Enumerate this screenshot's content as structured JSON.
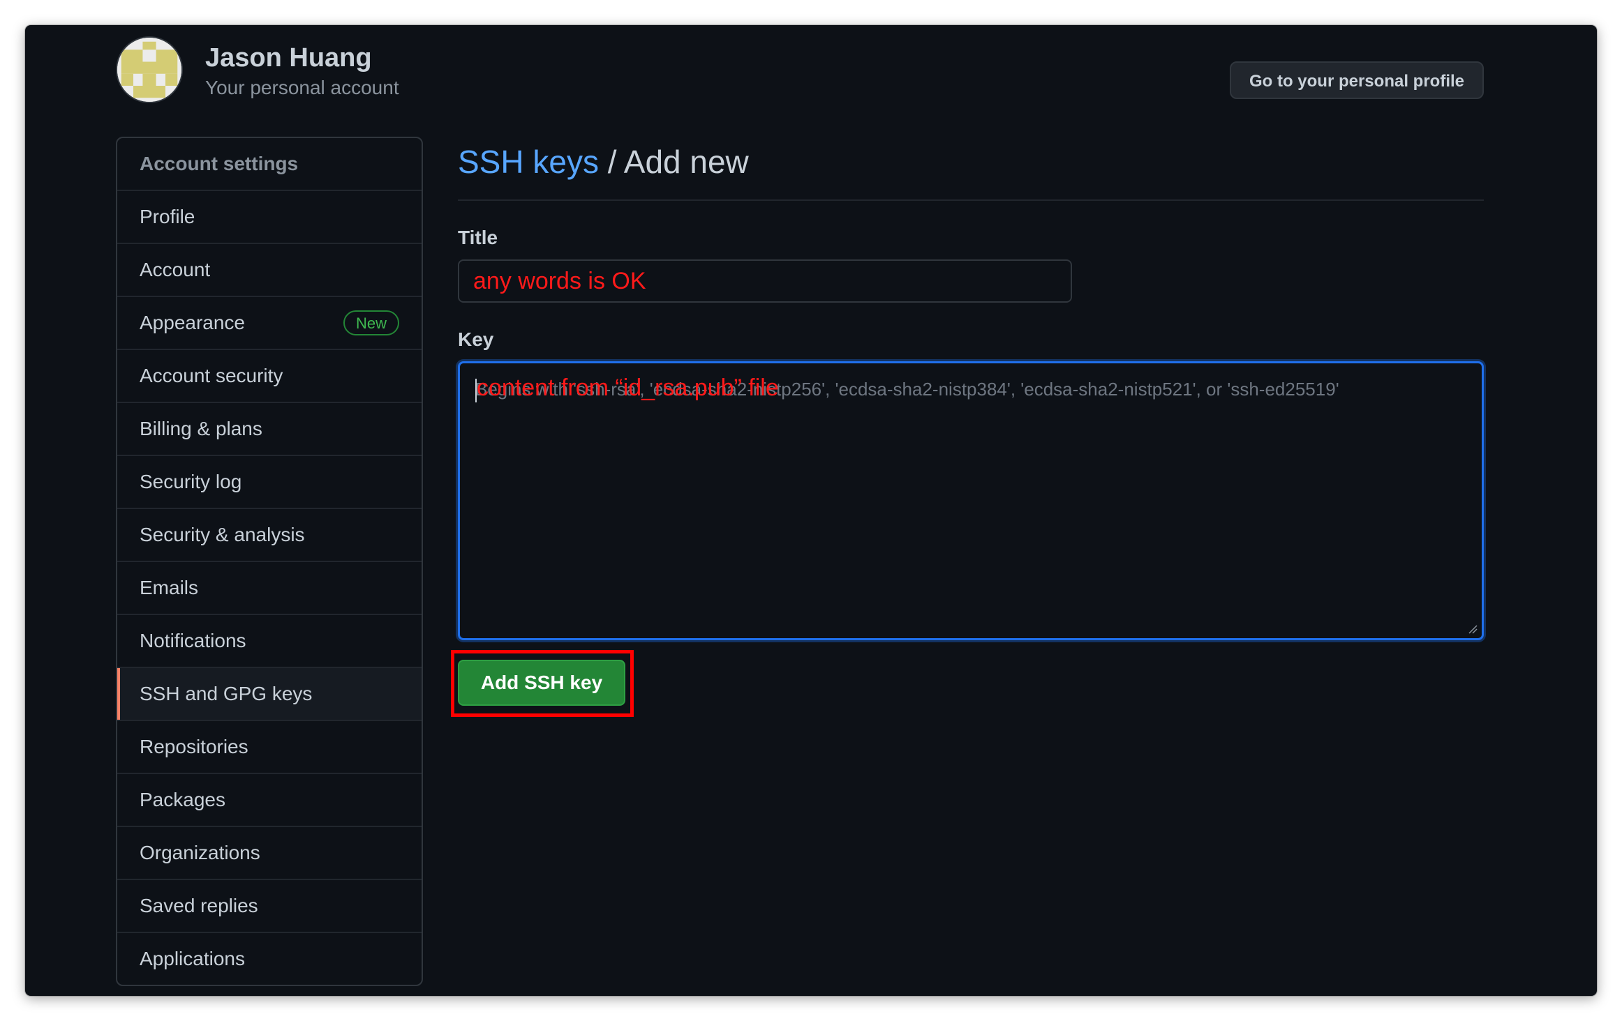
{
  "header": {
    "user_name": "Jason Huang",
    "user_subtitle": "Your personal account",
    "profile_button": "Go to your personal profile"
  },
  "sidebar": {
    "heading": "Account settings",
    "items": [
      {
        "label": "Profile"
      },
      {
        "label": "Account"
      },
      {
        "label": "Appearance",
        "badge": "New"
      },
      {
        "label": "Account security"
      },
      {
        "label": "Billing & plans"
      },
      {
        "label": "Security log"
      },
      {
        "label": "Security & analysis"
      },
      {
        "label": "Emails"
      },
      {
        "label": "Notifications"
      },
      {
        "label": "SSH and GPG keys",
        "selected": true
      },
      {
        "label": "Repositories"
      },
      {
        "label": "Packages"
      },
      {
        "label": "Organizations"
      },
      {
        "label": "Saved replies"
      },
      {
        "label": "Applications"
      }
    ]
  },
  "main": {
    "breadcrumb_link": "SSH keys",
    "breadcrumb_separator": " / ",
    "breadcrumb_current": "Add new",
    "title_label": "Title",
    "title_value": "any words is OK",
    "key_label": "Key",
    "key_placeholder": "Begins with 'ssh-rsa', 'ecdsa-sha2-nistp256', 'ecdsa-sha2-nistp384', 'ecdsa-sha2-nistp521', or 'ssh-ed25519'",
    "key_annotation": "content from “id_rsa.pub” file",
    "submit_label": "Add SSH key"
  },
  "colors": {
    "background": "#0d1117",
    "link": "#58a6ff",
    "primary_button": "#238636",
    "annotation": "#ff0000",
    "selected_indicator": "#f78166",
    "focus_border": "#1f6feb"
  },
  "icons": {
    "avatar": "identicon-avatar",
    "resize": "resize-grip-icon"
  }
}
